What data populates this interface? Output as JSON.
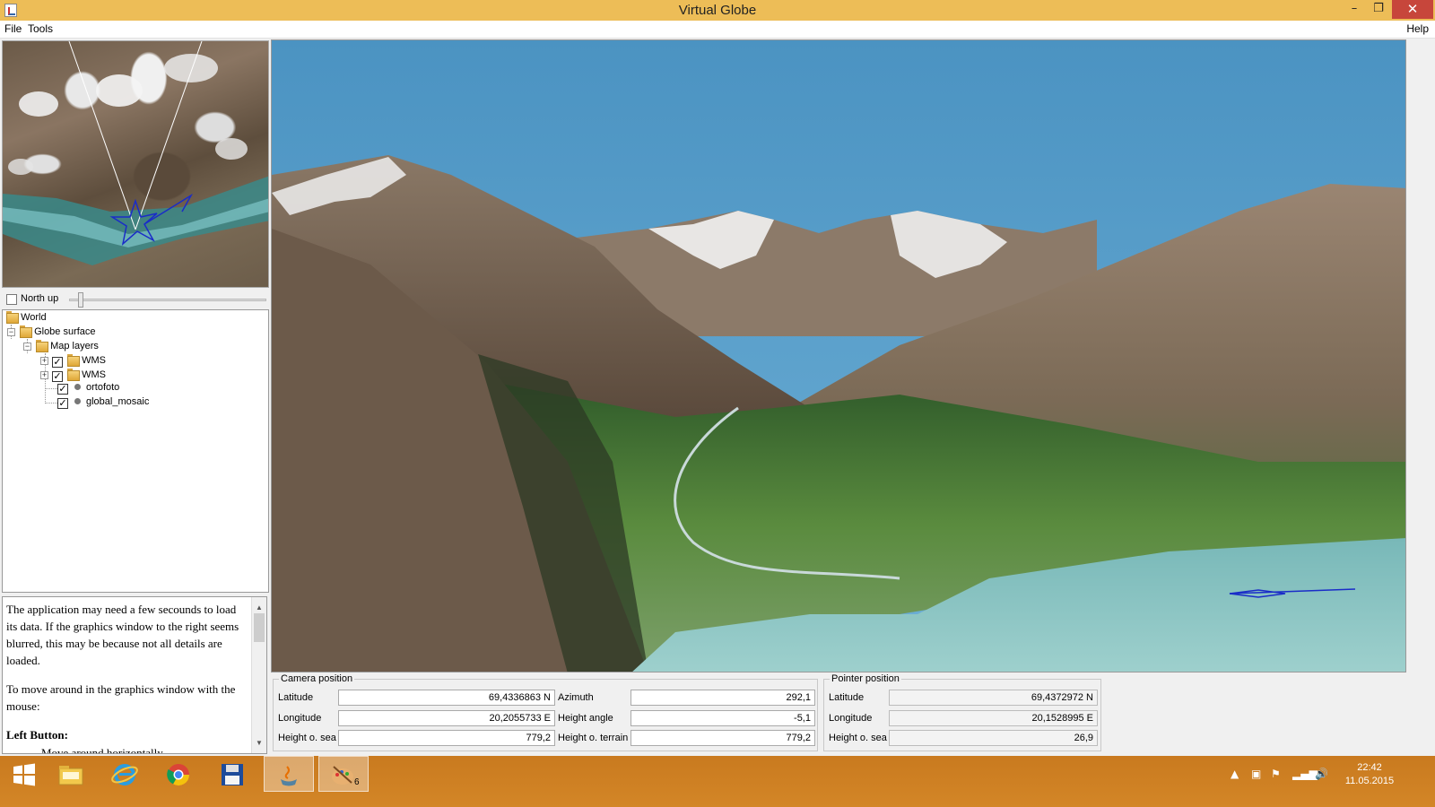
{
  "window": {
    "title": "Virtual Globe",
    "minimize": "–",
    "maximize": "❐",
    "close": "✕"
  },
  "menu": {
    "file": "File",
    "tools": "Tools",
    "help": "Help"
  },
  "minimap": {
    "north_up_label": "North up",
    "north_up_checked": false
  },
  "tree": {
    "world": "World",
    "globe_surface": "Globe surface",
    "map_layers": "Map layers",
    "layers": [
      {
        "label": "WMS",
        "checked": true,
        "kind": "folder"
      },
      {
        "label": "WMS",
        "checked": true,
        "kind": "folder"
      },
      {
        "label": "ortofoto",
        "checked": true,
        "kind": "layer"
      },
      {
        "label": "global_mosaic",
        "checked": true,
        "kind": "layer"
      }
    ]
  },
  "help": {
    "para1": "The application may need a few secounds to load its data. If the graphics window to the right seems blurred, this may be because not all details are loaded.",
    "para2": "To move around in the graphics window with the mouse:",
    "heading": "Left Button:",
    "item1": "Move around horizontally"
  },
  "camera": {
    "title": "Camera position",
    "latitude_label": "Latitude",
    "latitude": "69,4336863 N",
    "longitude_label": "Longitude",
    "longitude": "20,2055733 E",
    "height_sea_label": "Height o. sea",
    "height_sea": "779,2",
    "azimuth_label": "Azimuth",
    "azimuth": "292,1",
    "height_angle_label": "Height angle",
    "height_angle": "-5,1",
    "height_terrain_label": "Height o. terrain",
    "height_terrain": "779,2"
  },
  "pointer": {
    "title": "Pointer position",
    "latitude_label": "Latitude",
    "latitude": "69,4372972 N",
    "longitude_label": "Longitude",
    "longitude": "20,1528995 E",
    "height_sea_label": "Height o. sea",
    "height_sea": "26,9"
  },
  "taskbar": {
    "apps": [
      "start-icon",
      "file-explorer-icon",
      "internet-explorer-icon",
      "chrome-icon",
      "save-disk-icon",
      "java-icon",
      "paint-palette-icon"
    ],
    "palette_badge": "6",
    "time": "22:42",
    "date": "11.05.2015"
  },
  "colors": {
    "titlebar": "#edbd57",
    "taskbar": "#cd7f22",
    "sky": "#5aa0cc",
    "water": "#8ec7c5"
  }
}
